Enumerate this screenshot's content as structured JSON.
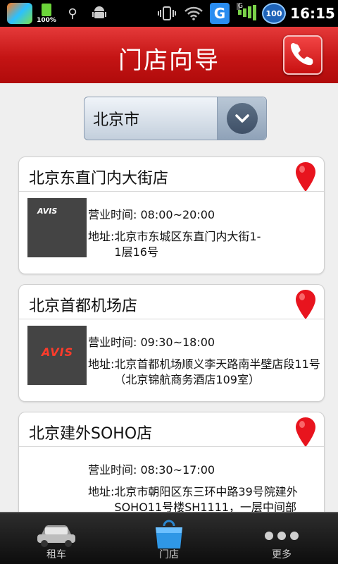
{
  "status_bar": {
    "battery_percent": "100%",
    "badge_number": "100",
    "network_letter": "G",
    "signal_letter": "G",
    "time": "16:15"
  },
  "header": {
    "title": "门店向导",
    "call_icon": "phone-icon"
  },
  "city_selector": {
    "selected": "北京市",
    "icon": "chevron-down-icon"
  },
  "stores": [
    {
      "name": "北京东直门内大街店",
      "hours_label": "营业时间: ",
      "hours": "08:00~20:00",
      "address_label": "地址:",
      "address": "北京市东城区东直门内大街1-1层16号",
      "photo_text": "AVIS"
    },
    {
      "name": "北京首都机场店",
      "hours_label": "营业时间: ",
      "hours": "09:30~18:00",
      "address_label": "地址:",
      "address": "北京首都机场顺义李天路南半壁店段11号（北京锦航商务酒店109室）",
      "photo_text": "AVIS"
    },
    {
      "name": "北京建外SOHO店",
      "hours_label": "营业时间: ",
      "hours": "08:30~17:00",
      "address_label": "地址:",
      "address": "北京市朝阳区东三环中路39号院建外SOHO11号楼SH1111，一层中间部"
    }
  ],
  "tabs": [
    {
      "label": "租车",
      "icon": "car-icon"
    },
    {
      "label": "门店",
      "icon": "shopping-bag-icon"
    },
    {
      "label": "更多",
      "icon": "more-dots-icon"
    }
  ],
  "colors": {
    "header_red": "#c41414",
    "pin_red": "#e8141e"
  }
}
